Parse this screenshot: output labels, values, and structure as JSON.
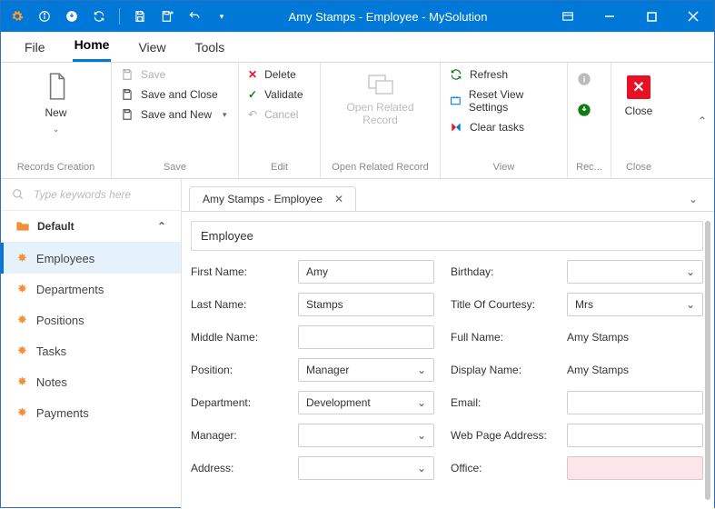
{
  "window": {
    "title": "Amy Stamps - Employee - MySolution"
  },
  "menuTabs": {
    "file": "File",
    "home": "Home",
    "view": "View",
    "tools": "Tools"
  },
  "ribbon": {
    "recordsCreation": {
      "new": "New",
      "label": "Records Creation"
    },
    "save": {
      "save": "Save",
      "saveClose": "Save and Close",
      "saveNew": "Save and New",
      "label": "Save"
    },
    "edit": {
      "delete": "Delete",
      "validate": "Validate",
      "cancel": "Cancel",
      "label": "Edit"
    },
    "openRelated": {
      "btn": "Open Related Record",
      "label": "Open Related Record"
    },
    "view": {
      "refresh": "Refresh",
      "reset": "Reset View Settings",
      "clear": "Clear tasks",
      "label": "View"
    },
    "rec": {
      "label": "Rec..."
    },
    "close": {
      "btn": "Close",
      "label": "Close"
    }
  },
  "search": {
    "placeholder": "Type keywords here"
  },
  "nav": {
    "group": "Default",
    "items": [
      "Employees",
      "Departments",
      "Positions",
      "Tasks",
      "Notes",
      "Payments"
    ]
  },
  "docTab": "Amy Stamps - Employee",
  "form": {
    "heading": "Employee",
    "labels": {
      "firstName": "First Name:",
      "lastName": "Last Name:",
      "middleName": "Middle Name:",
      "position": "Position:",
      "department": "Department:",
      "manager": "Manager:",
      "address": "Address:",
      "birthday": "Birthday:",
      "titleCourtesy": "Title Of Courtesy:",
      "fullName": "Full Name:",
      "displayName": "Display Name:",
      "email": "Email:",
      "webpage": "Web Page Address:",
      "office": "Office:"
    },
    "values": {
      "firstName": "Amy",
      "lastName": "Stamps",
      "middleName": "",
      "position": "Manager",
      "department": "Development",
      "manager": "",
      "address": "",
      "birthday": "",
      "titleCourtesy": "Mrs",
      "fullName": "Amy Stamps",
      "displayName": "Amy Stamps",
      "email": "",
      "webpage": "",
      "office": ""
    }
  }
}
